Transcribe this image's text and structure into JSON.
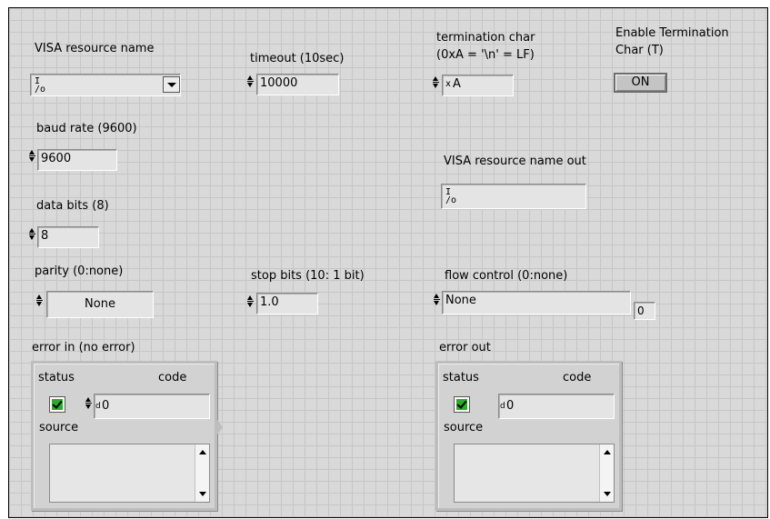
{
  "visa": {
    "label": "VISA resource name",
    "value": "",
    "icon": "io-visa-icon"
  },
  "timeout": {
    "label": "timeout (10sec)",
    "value": "10000"
  },
  "termination_char": {
    "label_line1": "termination char",
    "label_line2": "(0xA = '\\n' = LF)",
    "prefix": "x",
    "value": "A"
  },
  "enable_termination": {
    "label_line1": "Enable Termination",
    "label_line2": "Char (T)",
    "button_label": "ON"
  },
  "baud_rate": {
    "label": "baud rate (9600)",
    "value": "9600"
  },
  "data_bits": {
    "label": "data bits (8)",
    "value": "8"
  },
  "visa_out": {
    "label": "VISA resource name out",
    "value": ""
  },
  "parity": {
    "label": "parity (0:none)",
    "value": "None"
  },
  "stop_bits": {
    "label": "stop bits (10: 1 bit)",
    "value": "1.0"
  },
  "flow_control": {
    "label": "flow control (0:none)",
    "value": "None",
    "index": "0"
  },
  "error_in": {
    "label": "error in (no error)",
    "status_label": "status",
    "code_label": "code",
    "code_prefix": "d",
    "code_value": "0",
    "source_label": "source",
    "status_checked": true
  },
  "error_out": {
    "label": "error out",
    "status_label": "status",
    "code_label": "code",
    "code_prefix": "d",
    "code_value": "0",
    "source_label": "source",
    "status_checked": true
  },
  "colors": {
    "panel": "#d9d9d9",
    "grid": "#c6c6c6",
    "check": "#2ea82e"
  }
}
